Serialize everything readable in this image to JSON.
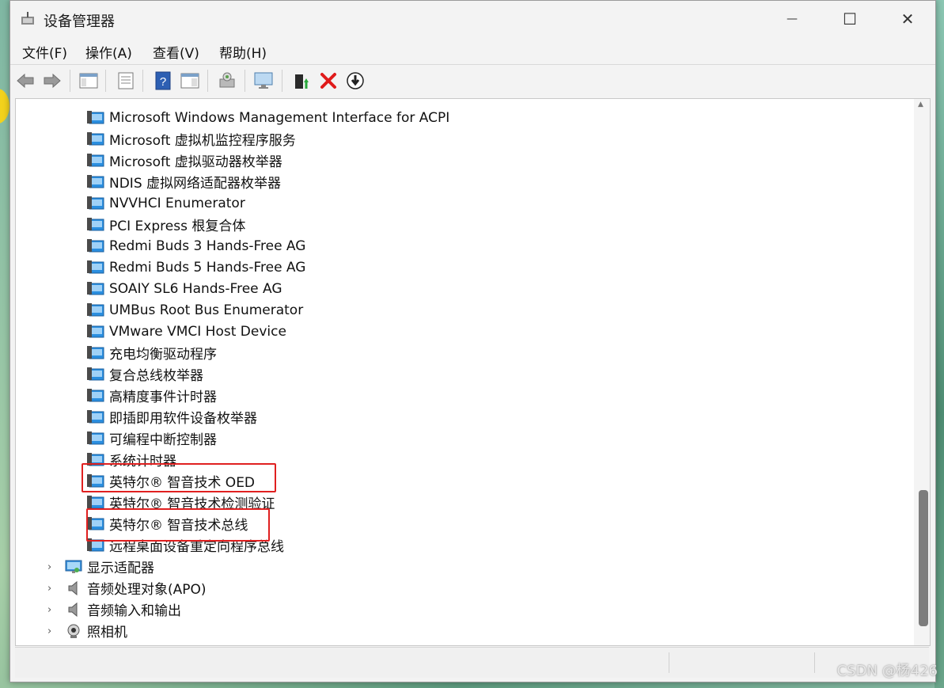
{
  "window": {
    "title": "设备管理器",
    "controls": {
      "minimize": "—",
      "maximize": "☐",
      "close": "✕"
    }
  },
  "menu": [
    "文件(F)",
    "操作(A)",
    "查看(V)",
    "帮助(H)"
  ],
  "toolbar_icons": [
    "back-arrow-icon",
    "forward-arrow-icon",
    "show-hide-tree-icon",
    "properties-icon",
    "help-icon",
    "view-icon",
    "scan-hardware-icon",
    "monitor-icon",
    "update-driver-icon",
    "uninstall-icon",
    "disable-icon"
  ],
  "tree": {
    "system_devices": [
      "Microsoft Windows Management Interface for ACPI",
      "Microsoft 虚拟机监控程序服务",
      "Microsoft 虚拟驱动器枚举器",
      "NDIS 虚拟网络适配器枚举器",
      "NVVHCI Enumerator",
      "PCI Express 根复合体",
      "Redmi Buds 3 Hands-Free AG",
      "Redmi Buds 5 Hands-Free AG",
      "SOAIY SL6 Hands-Free AG",
      "UMBus Root Bus Enumerator",
      "VMware VMCI Host Device",
      "充电均衡驱动程序",
      "复合总线枚举器",
      "高精度事件计时器",
      "即插即用软件设备枚举器",
      "可编程中断控制器",
      "系统计时器",
      "英特尔® 智音技术 OED",
      "英特尔® 智音技术检测验证",
      "英特尔® 智音技术总线",
      "远程桌面设备重定向程序总线"
    ],
    "categories": [
      {
        "label": "显示适配器",
        "icon": "display-adapter-icon"
      },
      {
        "label": "音频处理对象(APO)",
        "icon": "speaker-icon"
      },
      {
        "label": "音频输入和输出",
        "icon": "speaker-icon"
      },
      {
        "label": "照相机",
        "icon": "camera-icon"
      }
    ],
    "highlighted": [
      "英特尔® 智音技术 OED",
      "英特尔® 智音技术总线"
    ]
  },
  "watermark": "CSDN @杨426",
  "colors": {
    "highlight": "#e02020",
    "device_icon": "#1e7fd0"
  }
}
